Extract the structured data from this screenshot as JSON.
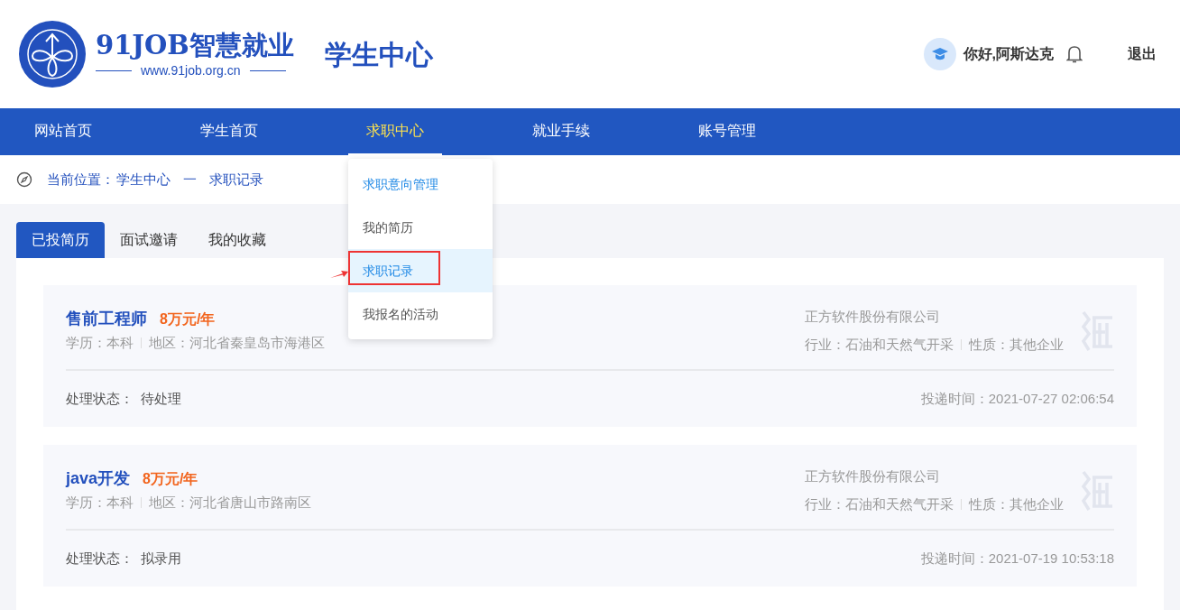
{
  "header": {
    "brand": "91JOB智慧就业",
    "url": "www.91job.org.cn",
    "title": "学生中心",
    "greeting": "你好,阿斯达克",
    "logout": "退出"
  },
  "nav": [
    {
      "label": "网站首页",
      "selected": false
    },
    {
      "label": "学生首页",
      "selected": false
    },
    {
      "label": "求职中心",
      "selected": true
    },
    {
      "label": "就业手续",
      "selected": false
    },
    {
      "label": "账号管理",
      "selected": false
    }
  ],
  "dropdown": [
    {
      "label": "求职意向管理",
      "selected": false,
      "kind": "link"
    },
    {
      "label": "我的简历",
      "selected": false,
      "kind": "plain"
    },
    {
      "label": "求职记录",
      "selected": true,
      "kind": "plain"
    },
    {
      "label": "我报名的活动",
      "selected": false,
      "kind": "plain"
    }
  ],
  "breadcrumb": {
    "label": "当前位置：",
    "items": [
      "学生中心",
      "一",
      "求职记录"
    ]
  },
  "tabs": [
    {
      "label": "已投简历",
      "selected": true
    },
    {
      "label": "面试邀请",
      "selected": false
    },
    {
      "label": "我的收藏",
      "selected": false
    }
  ],
  "records": [
    {
      "job": "售前工程师",
      "salary": "8万元/年",
      "education": "学历：本科",
      "region": "地区：河北省秦皇岛市海港区",
      "company": "正方软件股份有限公司",
      "industry": "行业：石油和天然气开采",
      "nature": "性质：其他企业",
      "status_label": "处理状态：",
      "status": "待处理",
      "time": "投递时间：2021-07-27 02:06:54"
    },
    {
      "job": "java开发",
      "salary": "8万元/年",
      "education": "学历：本科",
      "region": "地区：河北省唐山市路南区",
      "company": "正方软件股份有限公司",
      "industry": "行业：石油和天然气开采",
      "nature": "性质：其他企业",
      "status_label": "处理状态：",
      "status": "拟录用",
      "time": "投递时间：2021-07-19 10:53:18"
    }
  ]
}
